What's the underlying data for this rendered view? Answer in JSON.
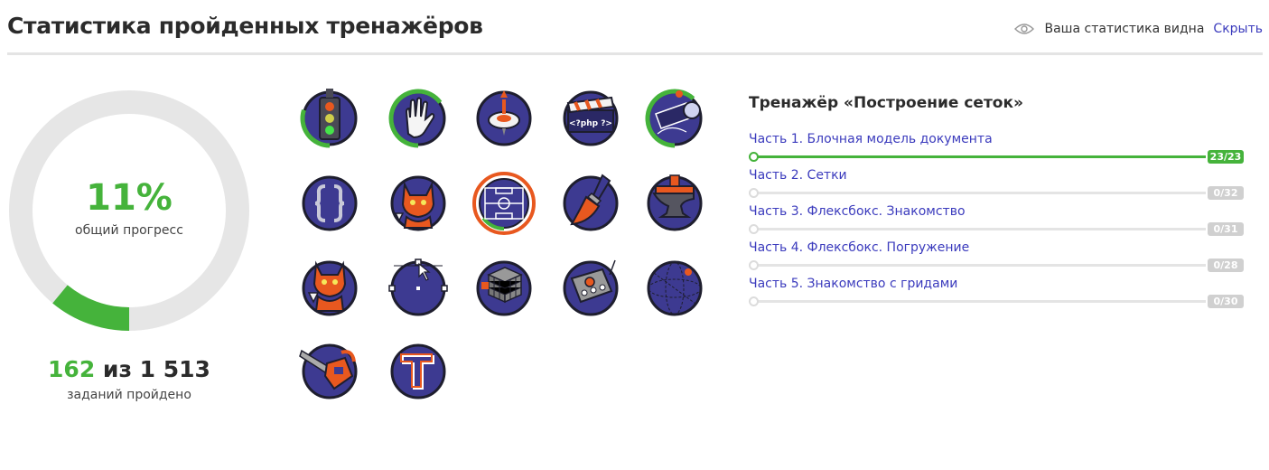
{
  "header": {
    "title": "Статистика пройденных тренажёров",
    "visibility_text": "Ваша статистика видна",
    "hide_link": "Скрыть"
  },
  "progress": {
    "percent_text": "11%",
    "percent_value": 0.11,
    "percent_label": "общий прогресс",
    "tasks_done": "162",
    "tasks_sep": " из ",
    "tasks_total": "1 513",
    "tasks_label": "заданий пройдено"
  },
  "trainers": [
    {
      "icon": "traffic-light-icon",
      "progress": 0.3
    },
    {
      "icon": "hand-icon",
      "progress": 0.65
    },
    {
      "icon": "spinning-top-icon",
      "progress": 0
    },
    {
      "icon": "php-clapperboard-icon",
      "progress": 0
    },
    {
      "icon": "telescope-icon",
      "progress": 0.62
    },
    {
      "icon": "curly-braces-icon",
      "progress": 0
    },
    {
      "icon": "cat-icon",
      "progress": 0
    },
    {
      "icon": "football-field-icon",
      "progress": 0.15,
      "selected": true
    },
    {
      "icon": "paint-brush-icon",
      "progress": 0
    },
    {
      "icon": "anvil-icon",
      "progress": 0
    },
    {
      "icon": "cat-icon",
      "progress": 0
    },
    {
      "icon": "vector-cursor-icon",
      "progress": 0
    },
    {
      "icon": "rubiks-cube-icon",
      "progress": 0
    },
    {
      "icon": "control-panel-icon",
      "progress": 0
    },
    {
      "icon": "orbit-sphere-icon",
      "progress": 0
    },
    {
      "icon": "chainsaw-icon",
      "progress": 0
    },
    {
      "icon": "typography-t-icon",
      "progress": 0
    }
  ],
  "detail": {
    "title": "Тренажёр «Построение сеток»",
    "parts": [
      {
        "label": "Часть 1. Блочная модель документа",
        "count": "23/23",
        "progress": 1
      },
      {
        "label": "Часть 2. Сетки",
        "count": "0/32",
        "progress": 0
      },
      {
        "label": "Часть 3. Флексбокс. Знакомство",
        "count": "0/31",
        "progress": 0
      },
      {
        "label": "Часть 4. Флексбокс. Погружение",
        "count": "0/28",
        "progress": 0
      },
      {
        "label": "Часть 5. Знакомство с гридами",
        "count": "0/30",
        "progress": 0
      }
    ]
  },
  "colors": {
    "accent_green": "#45b33b",
    "link_blue": "#3b3bbd",
    "badge_navy": "#3d3a91",
    "badge_orange": "#e8581f",
    "ring_track": "#e6e6e6"
  }
}
